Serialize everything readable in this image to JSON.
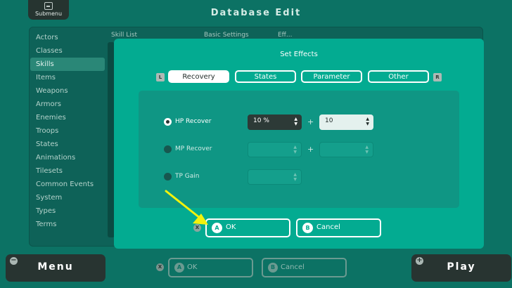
{
  "header": {
    "submenu_label": "Submenu",
    "title": "Database Edit"
  },
  "categories": {
    "items": [
      "Actors",
      "Classes",
      "Skills",
      "Items",
      "Weapons",
      "Armors",
      "Enemies",
      "Troops",
      "States",
      "Animations",
      "Tilesets",
      "Common Events",
      "System",
      "Types",
      "Terms"
    ],
    "selected": "Skills"
  },
  "background_tabs": [
    "Skill List",
    "Basic Settings",
    "Eff..."
  ],
  "dialog": {
    "title": "Set Effects",
    "left_shoulder": "L",
    "right_shoulder": "R",
    "tabs": [
      "Recovery",
      "States",
      "Parameter",
      "Other"
    ],
    "active_tab": "Recovery",
    "effects": [
      {
        "label": "HP Recover",
        "selected": true,
        "percent": "10 %",
        "plus": "+",
        "flat": "10"
      },
      {
        "label": "MP Recover",
        "selected": false,
        "percent": "",
        "plus": "+",
        "flat": ""
      },
      {
        "label": "TP Gain",
        "selected": false,
        "percent": ""
      }
    ],
    "cancel_hint": "X",
    "ok": {
      "badge": "A",
      "label": "OK"
    },
    "cancel": {
      "badge": "B",
      "label": "Cancel"
    }
  },
  "bottom_bar": {
    "menu_label": "Menu",
    "menu_badge": "−",
    "play_label": "Play",
    "play_badge": "+",
    "x_badge": "X",
    "ok": {
      "badge": "A",
      "label": "OK"
    },
    "cancel": {
      "badge": "B",
      "label": "Cancel"
    }
  },
  "colors": {
    "background": "#0c7264",
    "dialog": "#03ab91",
    "arrow": "#f2f20c"
  }
}
